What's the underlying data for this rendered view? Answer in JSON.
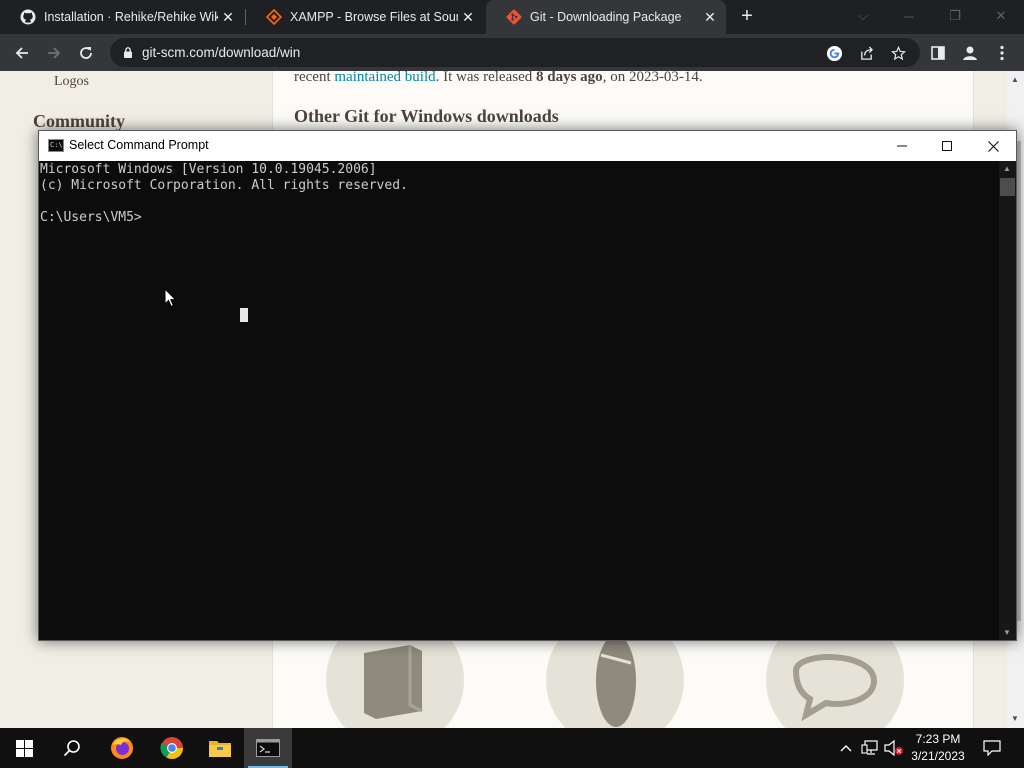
{
  "browser": {
    "tabs": [
      {
        "title": "Installation · Rehike/Rehike Wiki ·",
        "icon": "github-icon",
        "active": false
      },
      {
        "title": "XAMPP - Browse Files at SourceF",
        "icon": "sourceforge-icon",
        "active": false
      },
      {
        "title": "Git - Downloading Package",
        "icon": "git-icon",
        "active": true
      }
    ],
    "url": "git-scm.com/download/win"
  },
  "page": {
    "nav_logos": "Logos",
    "nav_community": "Community",
    "release_line": {
      "prefix": "recent ",
      "link": "maintained build",
      "mid": ". It was released ",
      "bold": "8 days ago",
      "suffix": ", on 2023-03-14."
    },
    "other_heading": "Other Git for Windows downloads"
  },
  "cmd": {
    "title": "Select Command Prompt",
    "icon_text": "C:\\",
    "lines": [
      "Microsoft Windows [Version 10.0.19045.2006]",
      "(c) Microsoft Corporation. All rights reserved.",
      "",
      "C:\\Users\\VM5>"
    ]
  },
  "taskbar": {
    "apps": [
      "windows-start",
      "search",
      "firefox",
      "chrome",
      "file-explorer",
      "command-prompt"
    ],
    "time": "7:23 PM",
    "date": "3/21/2023"
  },
  "colors": {
    "link": "#0388a6",
    "page_bg": "#f1eee5",
    "console_bg": "#0c0c0c",
    "git_orange": "#f05133"
  }
}
